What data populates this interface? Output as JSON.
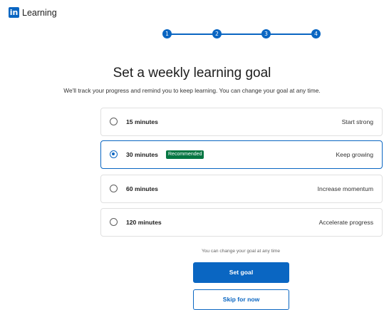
{
  "brand": {
    "logo_text": "in",
    "name": "Learning"
  },
  "stepper": {
    "steps": [
      "1",
      "2",
      "3",
      "4"
    ]
  },
  "header": {
    "title": "Set a weekly learning goal",
    "subtitle": "We'll track your progress and remind you to keep learning. You can change your goal at any time."
  },
  "options": [
    {
      "label": "15 minutes",
      "description": "Start strong",
      "selected": false
    },
    {
      "label": "30 minutes",
      "badge": "Recommended",
      "description": "Keep growing",
      "selected": true
    },
    {
      "label": "60 minutes",
      "description": "Increase momentum",
      "selected": false
    },
    {
      "label": "120 minutes",
      "description": "Accelerate progress",
      "selected": false
    }
  ],
  "footer": {
    "note": "You can change your goal at any time",
    "primary_button": "Set goal",
    "secondary_button": "Skip for now"
  },
  "colors": {
    "brand_blue": "#0a66c2",
    "badge_green": "#057642"
  }
}
